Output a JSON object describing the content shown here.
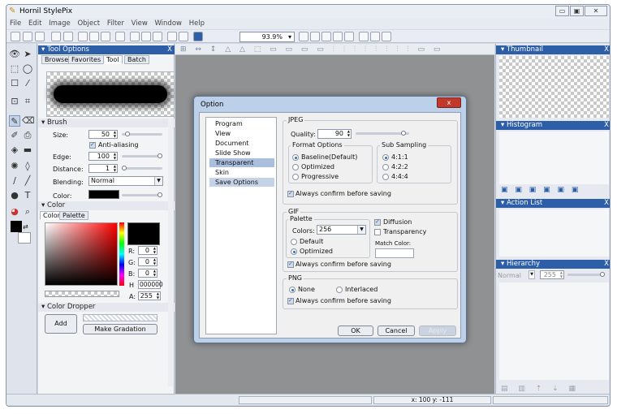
{
  "window": {
    "title": "Hornil StylePix",
    "min": "▭",
    "max": "▣",
    "close": "✕"
  },
  "menu": [
    "File",
    "Edit",
    "Image",
    "Object",
    "Filter",
    "View",
    "Window",
    "Help"
  ],
  "toolbar": {
    "zoom": "93.9%"
  },
  "tool_options": {
    "title": "Tool Options",
    "close": "X",
    "tabs": [
      "Browse",
      "Favorites",
      "Tool",
      "Batch"
    ],
    "brush": {
      "section": "Brush",
      "size_label": "Size:",
      "size": "50",
      "anti_aliasing": "Anti-aliasing",
      "edge_label": "Edge:",
      "edge": "100",
      "distance_label": "Distance:",
      "distance": "1",
      "blending_label": "Blending:",
      "blending": "Normal",
      "color_label": "Color:"
    },
    "color": {
      "section": "Color",
      "tabs": [
        "Color",
        "Palette"
      ],
      "r_label": "R:",
      "r": "0",
      "g_label": "G:",
      "g": "0",
      "b_label": "B:",
      "b": "0",
      "h_label": "H",
      "hex": "000000",
      "a_label": "A:",
      "a": "255"
    },
    "dropper": {
      "section": "Color Dropper",
      "add": "Add",
      "make_gradation": "Make Gradation"
    }
  },
  "right": {
    "thumbnail": "Thumbnail",
    "histogram": "Histogram",
    "action_list": "Action List",
    "hierarchy": "Hierarchy",
    "close": "X",
    "hierarchy_mode": "Normal",
    "hierarchy_opacity": "255"
  },
  "status": {
    "coords": "x: 100 y: -111"
  },
  "dialog": {
    "title": "Option",
    "close": "x",
    "nav": [
      "Program",
      "View",
      "Document",
      "Slide Show",
      "Transparent",
      "Skin",
      "Save Options"
    ],
    "jpeg": {
      "label": "JPEG",
      "quality_label": "Quality:",
      "quality": "90",
      "format_label": "Format Options",
      "format_opts": [
        "Baseline(Default)",
        "Optimized",
        "Progressive"
      ],
      "sub_label": "Sub Sampling",
      "sub_opts": [
        "4:1:1",
        "4:2:2",
        "4:4:4"
      ],
      "confirm": "Always confirm before saving"
    },
    "gif": {
      "label": "GIF",
      "palette_label": "Palette",
      "colors_label": "Colors:",
      "colors": "256",
      "palette_opts": [
        "Default",
        "Optimized"
      ],
      "diffusion": "Diffusion",
      "transparency": "Transparency",
      "match_color": "Match Color:",
      "confirm": "Always confirm before saving"
    },
    "png": {
      "label": "PNG",
      "opts": [
        "None",
        "Interlaced"
      ],
      "confirm": "Always confirm before saving"
    },
    "buttons": {
      "ok": "OK",
      "cancel": "Cancel",
      "apply": "Apply"
    }
  }
}
